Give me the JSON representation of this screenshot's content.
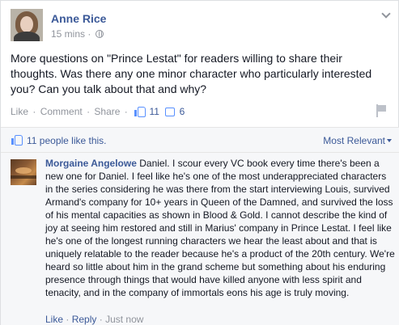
{
  "post": {
    "author": "Anne Rice",
    "time": "15 mins",
    "meta_separator": "·",
    "text": "More questions on \"Prince Lestat\" for readers willing to share their thoughts. Was there any one minor character who particularly interested you? Can you talk about that and why?",
    "actions": {
      "like": "Like",
      "comment": "Comment",
      "share": "Share",
      "separator": "·",
      "like_count": "11",
      "comment_count": "6"
    }
  },
  "likes_summary": {
    "text": "11 people like this.",
    "sort_label": "Most Relevant"
  },
  "comment": {
    "author": "Morgaine Angelowe",
    "text": "Daniel. I scour every VC book every time there's been a new one for Daniel. I feel like he's one of the most underappreciated characters in the series considering he was there from the start interviewing Louis, survived Armand's company for 10+ years in Queen of the Damned, and survived the loss of his mental capacities as shown in Blood & Gold. I cannot describe the kind of joy at seeing him restored and still in Marius' company in Prince Lestat. I feel like he's one of the longest running characters we hear the least about and that is uniquely relatable to the reader because he's a product of the 20th century. We're heard so little about him in the grand scheme but something about his enduring presence through things that would have killed anyone with less spirit and tenacity, and in the company of immortals eons his age is truly moving.",
    "like": "Like",
    "reply": "Reply",
    "time": "Just now",
    "separator": "·"
  },
  "icons": {
    "avatar": "profile-photo",
    "chevron": "chevron-down-icon",
    "globe": "globe-icon",
    "like": "thumbs-up-icon",
    "comment": "comment-bubble-icon",
    "flag": "flag-icon",
    "caret": "caret-down-icon"
  },
  "colors": {
    "link": "#3b5998",
    "muted": "#90949c",
    "accent": "#5890ff",
    "panel": "#f6f7f9"
  }
}
